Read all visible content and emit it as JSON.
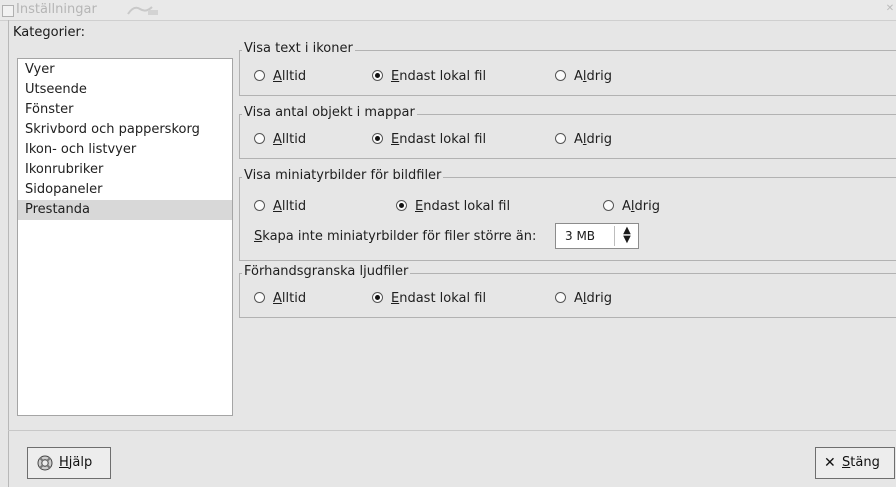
{
  "window": {
    "title": "Inställningar",
    "close_icon": "close-icon"
  },
  "categories": {
    "label": "Kategorier:",
    "items": [
      {
        "label": "Vyer"
      },
      {
        "label": "Utseende"
      },
      {
        "label": "Fönster"
      },
      {
        "label": "Skrivbord och papperskorg"
      },
      {
        "label": "Ikon- och listvyer"
      },
      {
        "label": "Ikonrubriker"
      },
      {
        "label": "Sidopaneler"
      },
      {
        "label": "Prestanda",
        "selected": true
      }
    ]
  },
  "sections": [
    {
      "title": "Visa text i ikoner",
      "options": [
        {
          "prefix": "",
          "key": "A",
          "rest": "lltid",
          "selected": false
        },
        {
          "prefix": "",
          "key": "E",
          "rest": "ndast lokal fil",
          "selected": true
        },
        {
          "prefix": "A",
          "key": "l",
          "rest": "drig",
          "selected": false
        }
      ]
    },
    {
      "title": "Visa antal objekt i mappar",
      "options": [
        {
          "prefix": "",
          "key": "A",
          "rest": "lltid",
          "selected": false
        },
        {
          "prefix": "",
          "key": "E",
          "rest": "ndast lokal fil",
          "selected": true
        },
        {
          "prefix": "A",
          "key": "l",
          "rest": "drig",
          "selected": false
        }
      ]
    },
    {
      "title": "Visa miniatyrbilder för bildfiler",
      "options": [
        {
          "prefix": "",
          "key": "A",
          "rest": "lltid",
          "selected": false
        },
        {
          "prefix": "",
          "key": "E",
          "rest": "ndast lokal fil",
          "selected": true
        },
        {
          "prefix": "A",
          "key": "l",
          "rest": "drig",
          "selected": false
        }
      ],
      "size_label_key": "S",
      "size_label_rest": "kapa inte miniatyrbilder för filer större än:",
      "size_value": "3 MB"
    },
    {
      "title": "Förhandsgranska ljudfiler",
      "options": [
        {
          "prefix": "",
          "key": "A",
          "rest": "lltid",
          "selected": false
        },
        {
          "prefix": "",
          "key": "E",
          "rest": "ndast lokal fil",
          "selected": true
        },
        {
          "prefix": "A",
          "key": "l",
          "rest": "drig",
          "selected": false
        }
      ]
    }
  ],
  "buttons": {
    "help_key": "H",
    "help_rest": "jälp",
    "close_key": "S",
    "close_rest": "täng"
  }
}
